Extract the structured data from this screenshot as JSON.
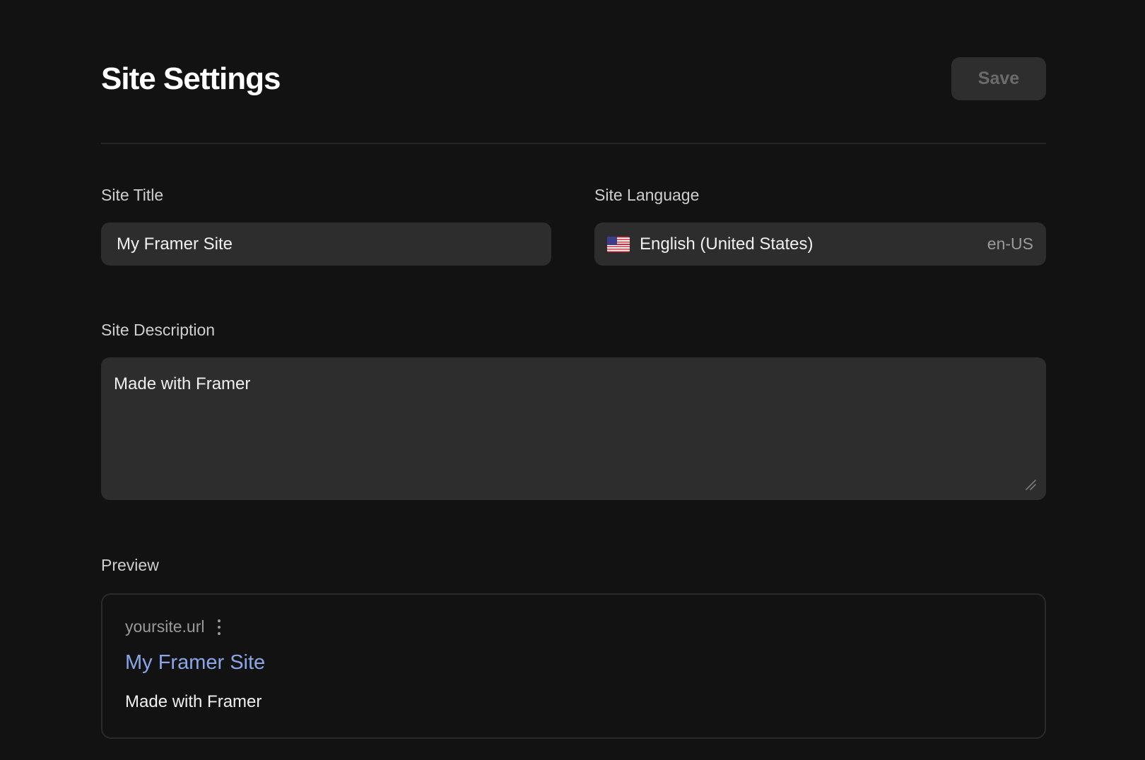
{
  "header": {
    "title": "Site Settings",
    "save_label": "Save"
  },
  "site_title": {
    "label": "Site Title",
    "value": "My Framer Site"
  },
  "site_language": {
    "label": "Site Language",
    "name": "English (United States)",
    "code": "en-US",
    "flag_icon": "us-flag-icon"
  },
  "site_description": {
    "label": "Site Description",
    "value": "Made with Framer"
  },
  "preview": {
    "label": "Preview",
    "url": "yoursite.url",
    "title": "My Framer Site",
    "description": "Made with Framer",
    "title_color": "#8aa6e8"
  },
  "colors": {
    "background": "#121212",
    "field": "#2d2d2d",
    "link": "#8aa6e8"
  }
}
